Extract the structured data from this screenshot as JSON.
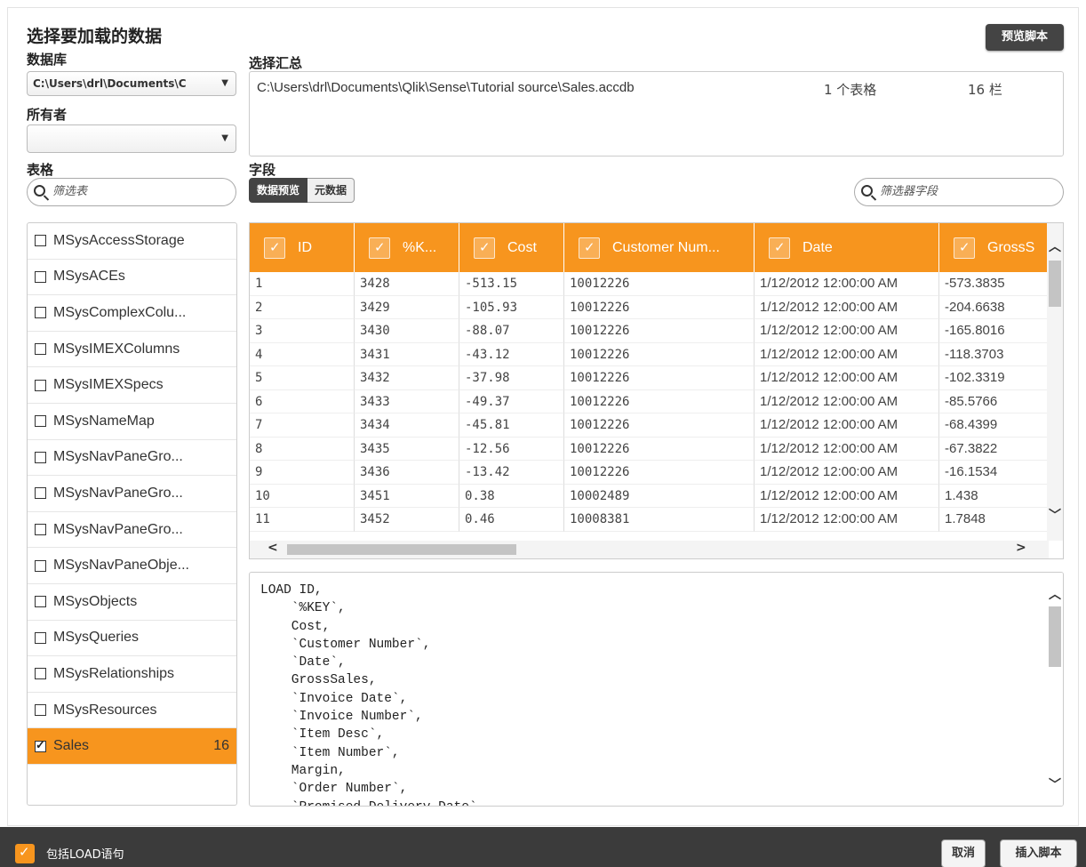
{
  "header": {
    "title": "选择要加载的数据",
    "preview_script_button": "预览脚本"
  },
  "left": {
    "database_label": "数据库",
    "database_value": "C:\\Users\\drl\\Documents\\C",
    "owner_label": "所有者",
    "owner_value": "",
    "tables_label": "表格",
    "tables_search_placeholder": "筛选表",
    "tables": [
      {
        "name": "MSysAccessStorage",
        "selected": false,
        "count": ""
      },
      {
        "name": "MSysACEs",
        "selected": false,
        "count": ""
      },
      {
        "name": "MSysComplexColu...",
        "selected": false,
        "count": ""
      },
      {
        "name": "MSysIMEXColumns",
        "selected": false,
        "count": ""
      },
      {
        "name": "MSysIMEXSpecs",
        "selected": false,
        "count": ""
      },
      {
        "name": "MSysNameMap",
        "selected": false,
        "count": ""
      },
      {
        "name": "MSysNavPaneGro...",
        "selected": false,
        "count": ""
      },
      {
        "name": "MSysNavPaneGro...",
        "selected": false,
        "count": ""
      },
      {
        "name": "MSysNavPaneGro...",
        "selected": false,
        "count": ""
      },
      {
        "name": "MSysNavPaneObje...",
        "selected": false,
        "count": ""
      },
      {
        "name": "MSysObjects",
        "selected": false,
        "count": ""
      },
      {
        "name": "MSysQueries",
        "selected": false,
        "count": ""
      },
      {
        "name": "MSysRelationships",
        "selected": false,
        "count": ""
      },
      {
        "name": "MSysResources",
        "selected": false,
        "count": ""
      },
      {
        "name": "Sales",
        "selected": true,
        "count": "16"
      }
    ]
  },
  "summary": {
    "label": "选择汇总",
    "path": "C:\\Users\\drl\\Documents\\Qlik\\Sense\\Tutorial source\\Sales.accdb",
    "tables_count": "1 个表格",
    "fields_count": "16 栏"
  },
  "fields": {
    "label": "字段",
    "tab_preview": "数据预览",
    "tab_metadata": "元数据",
    "search_placeholder": "筛选器字段"
  },
  "grid": {
    "columns": [
      "ID",
      "%K...",
      "Cost",
      "Customer Num...",
      "Date",
      "GrossS"
    ],
    "rows": [
      [
        "1",
        "3428",
        "-513.15",
        "10012226",
        "1/12/2012 12:00:00 AM",
        "-573.3835"
      ],
      [
        "2",
        "3429",
        "-105.93",
        "10012226",
        "1/12/2012 12:00:00 AM",
        "-204.6638"
      ],
      [
        "3",
        "3430",
        "-88.07",
        "10012226",
        "1/12/2012 12:00:00 AM",
        "-165.8016"
      ],
      [
        "4",
        "3431",
        "-43.12",
        "10012226",
        "1/12/2012 12:00:00 AM",
        "-118.3703"
      ],
      [
        "5",
        "3432",
        "-37.98",
        "10012226",
        "1/12/2012 12:00:00 AM",
        "-102.3319"
      ],
      [
        "6",
        "3433",
        "-49.37",
        "10012226",
        "1/12/2012 12:00:00 AM",
        "-85.5766"
      ],
      [
        "7",
        "3434",
        "-45.81",
        "10012226",
        "1/12/2012 12:00:00 AM",
        "-68.4399"
      ],
      [
        "8",
        "3435",
        "-12.56",
        "10012226",
        "1/12/2012 12:00:00 AM",
        "-67.3822"
      ],
      [
        "9",
        "3436",
        "-13.42",
        "10012226",
        "1/12/2012 12:00:00 AM",
        "-16.1534"
      ],
      [
        "10",
        "3451",
        "0.38",
        "10002489",
        "1/12/2012 12:00:00 AM",
        "1.438"
      ],
      [
        "11",
        "3452",
        "0.46",
        "10008381",
        "1/12/2012 12:00:00 AM",
        "1.7848"
      ]
    ]
  },
  "script": {
    "lines": [
      "LOAD ID,",
      "    `%KEY`,",
      "    Cost,",
      "    `Customer Number`,",
      "    `Date`,",
      "    GrossSales,",
      "    `Invoice Date`,",
      "    `Invoice Number`,",
      "    `Item Desc`,",
      "    `Item Number`,",
      "    Margin,",
      "    `Order Number`,",
      "    `Promised Delivery Date`,"
    ]
  },
  "footer": {
    "include_load_label": "包括LOAD语句",
    "include_load_checked": true,
    "cancel_button": "取消",
    "insert_script_button": "插入脚本"
  },
  "colors": {
    "accent": "#f7951e",
    "dark": "#3b3b3b"
  }
}
